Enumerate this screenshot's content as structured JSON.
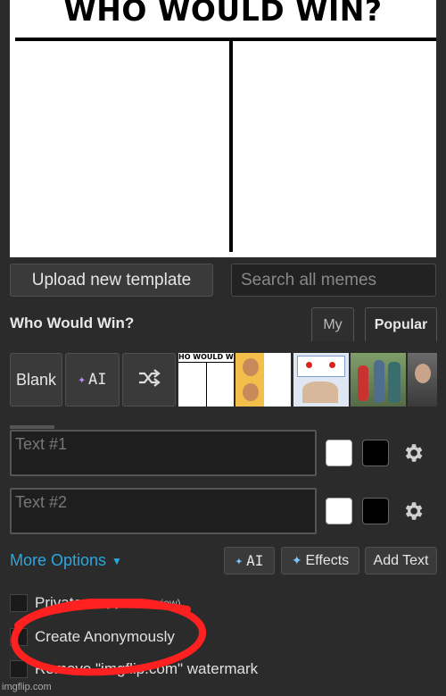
{
  "meme_preview": {
    "title": "WHO WOULD WIN?"
  },
  "toolbar": {
    "upload_label": "Upload new template",
    "search_placeholder": "Search all memes"
  },
  "template_header": {
    "title": "Who Would Win?",
    "tabs": [
      {
        "label": "My",
        "active": false
      },
      {
        "label": "Popular",
        "active": true
      }
    ]
  },
  "template_picker": {
    "blank_label": "Blank",
    "ai_label": "AI",
    "shuffle_icon": "shuffle-icon",
    "thumbnails": [
      {
        "caption": "HO WOULD WI"
      }
    ]
  },
  "text_boxes": [
    {
      "placeholder": "Text #1",
      "fill_color": "#ffffff",
      "outline_color": "#000000"
    },
    {
      "placeholder": "Text #2",
      "fill_color": "#ffffff",
      "outline_color": "#000000"
    }
  ],
  "options_bar": {
    "more_options_label": "More Options",
    "ai_label": "AI",
    "effects_label": "Effects",
    "add_text_label": "Add Text"
  },
  "checkboxes": {
    "private_label": "Private",
    "private_sub": "(only you can view)",
    "anonymous_label": "Create Anonymously",
    "watermark_label": "Remove \"imgflip.com\" watermark"
  },
  "watermark_text": "imgflip.com",
  "colors": {
    "accent_blue": "#29a8e0",
    "annotation_red": "#ff2020",
    "panel_bg": "#2b2b2b"
  }
}
